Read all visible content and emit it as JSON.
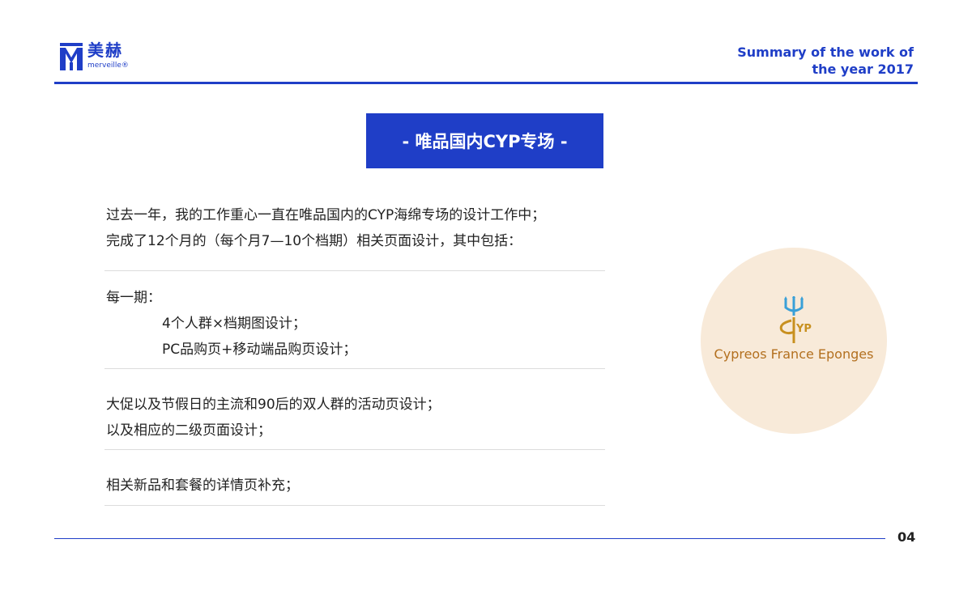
{
  "brand": {
    "name_cn": "美赫",
    "name_en": "merveille®",
    "color": "#1f3ec7"
  },
  "header": {
    "title_line1": "Summary of the work of",
    "title_line2": "the year 2017"
  },
  "section": {
    "title": "- 唯品国内CYP专场 -"
  },
  "intro": {
    "line1": "过去一年，我的工作重心一直在唯品国内的CYP海绵专场的设计工作中；",
    "line2": "完成了12个月的（每个月7—10个档期）相关页面设计，其中包括："
  },
  "group1": {
    "heading": "每一期：",
    "item1": "4个人群×档期图设计；",
    "item2": "PC品购页+移动端品购页设计；"
  },
  "group2": {
    "line1": "大促以及节假日的主流和90后的双人群的活动页设计；",
    "line2": "以及相应的二级页面设计；"
  },
  "group3": {
    "line1": "相关新品和套餐的详情页补充；"
  },
  "cyp_logo": {
    "text": "Cypreos France Eponges",
    "mark_text": "YP",
    "trident_color": "#3aa0d8",
    "gold_color": "#c8901f",
    "background": "#f8ead9"
  },
  "footer": {
    "page_number": "04"
  }
}
